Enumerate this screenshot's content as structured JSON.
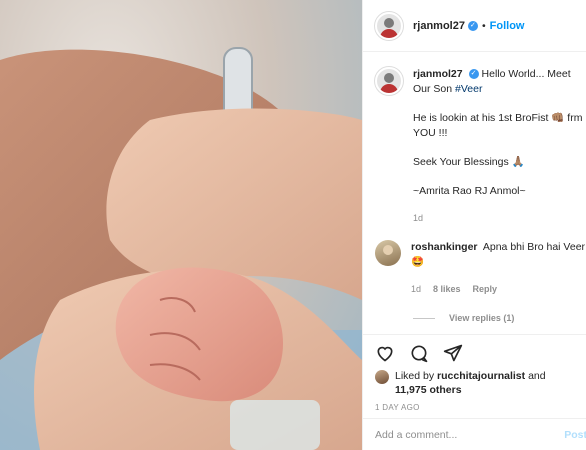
{
  "header": {
    "username": "rjanmol27",
    "verified_icon": "verified-badge-icon",
    "separator": "•",
    "follow_label": "Follow"
  },
  "caption": {
    "username": "rjanmol27",
    "line1": "Hello World... Meet Our Son",
    "hashtag": "#Veer",
    "line2": "He is lookin at his 1st BroFist 👊🏽 frm YOU !!!",
    "line3": "Seek Your Blessings 🙏🏽",
    "line4": "~Amrita Rao RJ Anmol~",
    "age": "1d"
  },
  "comment": {
    "username": "roshankinger",
    "text": "Apna bhi Bro hai Veer🤩",
    "age": "1d",
    "likes": "8 likes",
    "reply_label": "Reply",
    "view_replies": "View replies (1)"
  },
  "actions": {
    "icons": [
      "heart-icon",
      "comment-icon",
      "share-icon"
    ],
    "liked_by_prefix": "Liked by",
    "liked_by_user": "rucchitajournalist",
    "liked_by_mid": "and",
    "liked_by_count": "11,975 others",
    "timestamp": "1 DAY AGO"
  },
  "add_comment": {
    "placeholder": "Add a comment...",
    "post_label": "Post"
  },
  "colors": {
    "link_blue": "#0095f6",
    "hashtag": "#00376b",
    "muted": "#8e8e8e"
  }
}
